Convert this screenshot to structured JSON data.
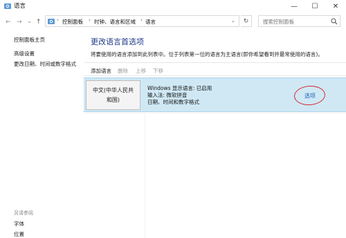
{
  "window": {
    "title": "语言",
    "icon": "control-panel-icon",
    "min_glyph": "—",
    "max_glyph": "☐",
    "close_glyph": "✕"
  },
  "nav": {
    "back": "←",
    "forward": "→",
    "recent": "⌄",
    "up": "↑",
    "address_icon": "control-panel-icon",
    "breadcrumbs": [
      "控制面板",
      "时钟、语言和区域",
      "语言"
    ],
    "sep": "›",
    "dropdown": "⌄",
    "refresh": "↻",
    "search_placeholder": "搜索控制面板"
  },
  "sidebar": {
    "home": "控制面板主页",
    "items": [
      "高级设置",
      "更改日期、时间或数字格式"
    ],
    "see_also_heading": "另请参阅",
    "see_also": [
      "字体",
      "位置"
    ]
  },
  "main": {
    "title": "更改语言首选项",
    "description": "将要使用的语言添加到此列表中。位于列表第一位的语言为主语言(即你希望看到并最常使用的语言)。",
    "toolbar": {
      "add": "添加语言",
      "remove": "删除",
      "up": "上移",
      "down": "下移"
    },
    "languages": [
      {
        "name": "中文(中华人民共和国)",
        "details": [
          "Windows 显示语言: 已启用",
          "输入法: 微软拼音",
          "日期、时间和数字格式"
        ],
        "options_label": "选项"
      }
    ]
  },
  "colors": {
    "selected_row": "#cfe8f4",
    "link": "#1f5fb7",
    "annotation_circle": "#d8262d",
    "title": "#1e3a8a"
  }
}
